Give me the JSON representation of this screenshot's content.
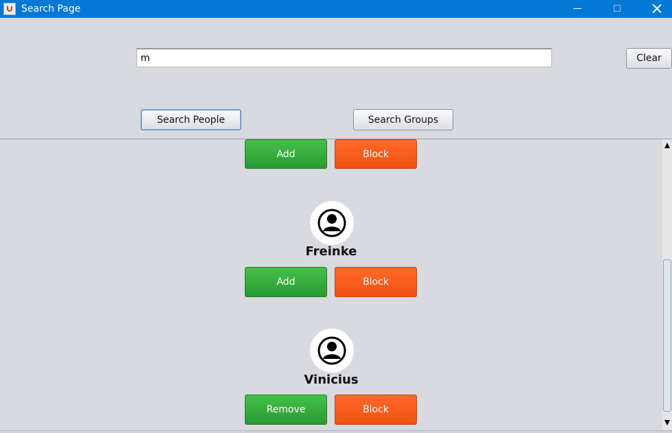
{
  "window": {
    "title": "Search Page",
    "icon": "java-app-icon",
    "accent_color": "#0078d4"
  },
  "search": {
    "value": "m",
    "clear_label": "Clear",
    "search_people_label": "Search People",
    "search_groups_label": "Search Groups"
  },
  "results": {
    "partial_row": {
      "add_label": "Add",
      "block_label": "Block"
    },
    "people": [
      {
        "name": "Freinke",
        "action_label": "Add",
        "block_label": "Block",
        "avatar_icon": "user-avatar-icon"
      },
      {
        "name": "Vinicius",
        "action_label": "Remove",
        "block_label": "Block",
        "avatar_icon": "user-avatar-icon"
      }
    ]
  },
  "colors": {
    "add_button": "#35ad3b",
    "block_button": "#fb5a1c",
    "background": "#d8dae0"
  }
}
